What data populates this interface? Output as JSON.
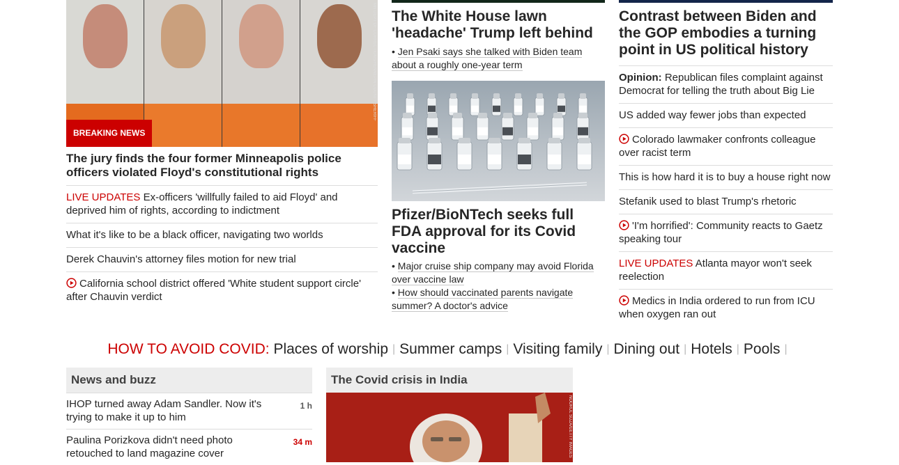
{
  "lead": {
    "image_badge": "BREAKING NEWS",
    "image_credit": "MN DEPT OF CORRECTIONS/HENNEPIN COUNTY SHERIFF",
    "headline": "The jury finds the four former Minneapolis police officers violated Floyd's constitutional rights",
    "items": [
      {
        "type": "live",
        "prefix": "LIVE UPDATES",
        "text": "Ex-officers 'willfully failed to aid Floyd' and deprived him of rights, according to indictment"
      },
      {
        "type": "plain",
        "text": "What it's like to be a black officer, navigating two worlds"
      },
      {
        "type": "plain",
        "text": "Derek Chauvin's attorney files motion for new trial"
      },
      {
        "type": "video",
        "text": "California school district offered 'White student support circle' after Chauvin verdict"
      }
    ]
  },
  "middle": {
    "story1": {
      "headline": "The White House lawn 'headache' Trump left behind",
      "bullets": [
        "Jen Psaki says she talked with Biden team about a roughly one-year term"
      ]
    },
    "story2": {
      "headline": "Pfizer/BioNTech seeks full FDA approval for its Covid vaccine",
      "bullets": [
        "Major cruise ship company may avoid Florida over vaccine law",
        "How should vaccinated parents navigate summer? A doctor's advice"
      ]
    }
  },
  "right": {
    "headline": "Contrast between Biden and the GOP embodies a turning point in US political history",
    "items": [
      {
        "type": "opinion",
        "prefix": "Opinion:",
        "text": "Republican files complaint against Democrat for telling the truth about Big Lie"
      },
      {
        "type": "plain",
        "text": "US added way fewer jobs than expected"
      },
      {
        "type": "video",
        "text": "Colorado lawmaker confronts colleague over racist term"
      },
      {
        "type": "plain",
        "text": "This is how hard it is to buy a house right now"
      },
      {
        "type": "plain",
        "text": "Stefanik used to blast Trump's rhetoric"
      },
      {
        "type": "video",
        "text": "'I'm horrified': Community reacts to Gaetz speaking tour"
      },
      {
        "type": "live",
        "prefix": "LIVE UPDATES",
        "text": "Atlanta mayor won't seek reelection"
      },
      {
        "type": "video",
        "text": "Medics in India ordered to run from ICU when oxygen ran out"
      }
    ]
  },
  "covid_strip": {
    "label": "HOW TO AVOID COVID:",
    "links": [
      "Places of worship",
      "Summer camps",
      "Visiting family",
      "Dining out",
      "Hotels",
      "Pools"
    ]
  },
  "news_buzz": {
    "title": "News and buzz",
    "items": [
      {
        "text": "IHOP turned away Adam Sandler. Now it's trying to make it up to him",
        "time": "1 h",
        "time_color": "#595959"
      },
      {
        "text": "Paulina Porizkova didn't need photo retouched to land magazine cover",
        "time": "34 m",
        "time_color": "#cc0000"
      }
    ]
  },
  "india_zone": {
    "title": "The Covid crisis in India",
    "image_credit": "NOORUL SUZA/GETTY IMAGES"
  },
  "colors": {
    "accent_red": "#cc0000",
    "text": "#262626"
  }
}
